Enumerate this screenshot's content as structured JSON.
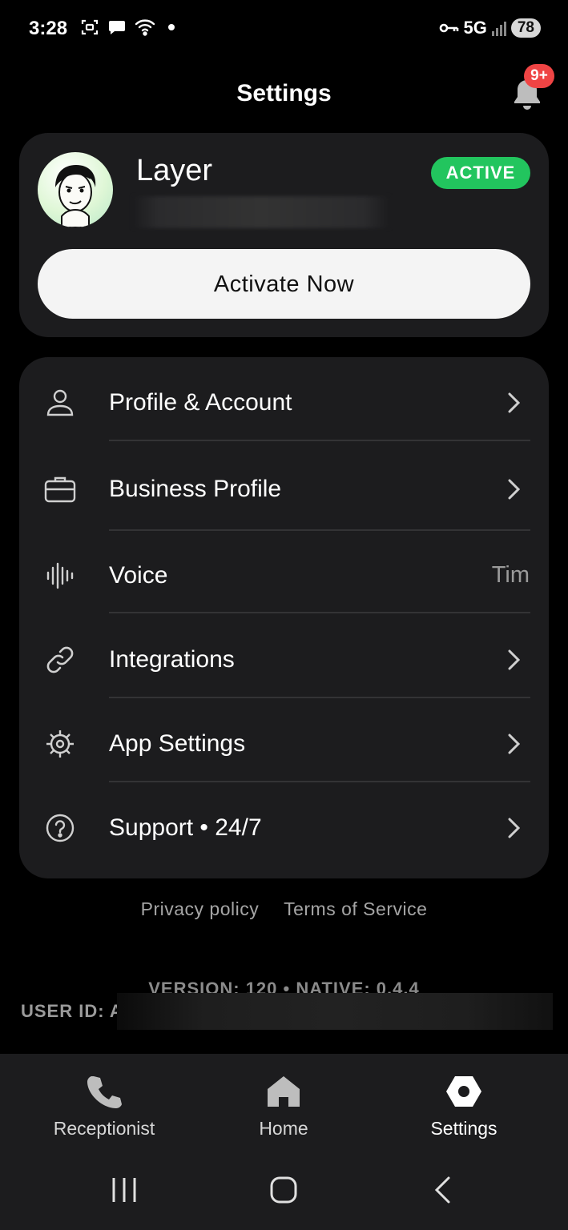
{
  "status_bar": {
    "time": "3:28",
    "network": "5G",
    "battery": "78"
  },
  "header": {
    "title": "Settings",
    "notification_badge": "9+"
  },
  "profile": {
    "name": "Layer",
    "status": "ACTIVE",
    "activate_label": "Activate Now"
  },
  "menu": {
    "items": [
      {
        "label": "Profile & Account",
        "icon": "person-icon"
      },
      {
        "label": "Business Profile",
        "icon": "briefcase-icon"
      },
      {
        "label": "Voice",
        "icon": "waveform-icon",
        "value": "Tim"
      },
      {
        "label": "Integrations",
        "icon": "link-icon"
      },
      {
        "label": "App Settings",
        "icon": "gear-icon"
      },
      {
        "label": "Support • 24/7",
        "icon": "help-icon"
      }
    ]
  },
  "footer": {
    "privacy": "Privacy policy",
    "terms": "Terms of Service",
    "version": "VERSION: 120 • NATIVE: 0.4.4",
    "user_id": "USER ID: A"
  },
  "bottom_nav": {
    "items": [
      {
        "label": "Receptionist",
        "icon": "phone-icon"
      },
      {
        "label": "Home",
        "icon": "home-icon"
      },
      {
        "label": "Settings",
        "icon": "settings-hex-icon",
        "active": true
      }
    ]
  },
  "colors": {
    "accent_active": "#22c55e",
    "badge": "#ef4444",
    "card": "#1c1c1e"
  }
}
